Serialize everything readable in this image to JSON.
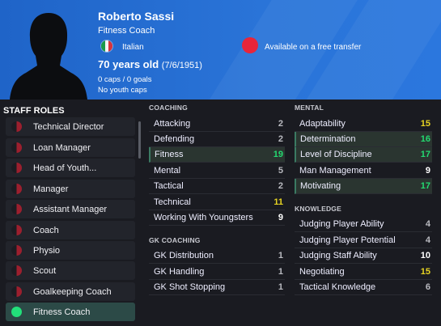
{
  "profile": {
    "name": "Roberto Sassi",
    "job": "Fitness Coach",
    "nationality": "Italian",
    "transfer_status": "Available on a free transfer",
    "age": "70 years old",
    "dob": "(7/6/1951)",
    "caps": "0 caps / 0 goals",
    "youth_caps": "No youth caps"
  },
  "roles": {
    "title": "STAFF ROLES",
    "items": [
      {
        "label": "Technical Director"
      },
      {
        "label": "Loan Manager"
      },
      {
        "label": "Head of Youth..."
      },
      {
        "label": "Manager"
      },
      {
        "label": "Assistant Manager"
      },
      {
        "label": "Coach"
      },
      {
        "label": "Physio"
      },
      {
        "label": "Scout"
      },
      {
        "label": "Goalkeeping Coach"
      },
      {
        "label": "Fitness Coach"
      }
    ]
  },
  "coaching": {
    "title": "COACHING",
    "items": [
      {
        "label": "Attacking",
        "value": "2"
      },
      {
        "label": "Defending",
        "value": "2"
      },
      {
        "label": "Fitness",
        "value": "19"
      },
      {
        "label": "Mental",
        "value": "5"
      },
      {
        "label": "Tactical",
        "value": "2"
      },
      {
        "label": "Technical",
        "value": "11"
      },
      {
        "label": "Working With Youngsters",
        "value": "9"
      }
    ]
  },
  "gk_coaching": {
    "title": "GK COACHING",
    "items": [
      {
        "label": "GK Distribution",
        "value": "1"
      },
      {
        "label": "GK Handling",
        "value": "1"
      },
      {
        "label": "GK Shot Stopping",
        "value": "1"
      }
    ]
  },
  "mental": {
    "title": "MENTAL",
    "items": [
      {
        "label": "Adaptability",
        "value": "15"
      },
      {
        "label": "Determination",
        "value": "16"
      },
      {
        "label": "Level of Discipline",
        "value": "17"
      },
      {
        "label": "Man Management",
        "value": "9"
      },
      {
        "label": "Motivating",
        "value": "17"
      }
    ]
  },
  "knowledge": {
    "title": "KNOWLEDGE",
    "items": [
      {
        "label": "Judging Player Ability",
        "value": "4"
      },
      {
        "label": "Judging Player Potential",
        "value": "4"
      },
      {
        "label": "Judging Staff Ability",
        "value": "10"
      },
      {
        "label": "Negotiating",
        "value": "15"
      },
      {
        "label": "Tactical Knowledge",
        "value": "6"
      }
    ]
  },
  "colors": {
    "header_blue": "#2a74d8",
    "highlight_green": "#24d970",
    "value_yellow": "#e6d322",
    "transfer_red": "#e8253a"
  },
  "icons": {
    "avatar": "person-silhouette-icon",
    "flag": "italy-flag-icon",
    "transfer": "transfer-status-dot-icon",
    "role_status": "role-indicator-icon"
  }
}
